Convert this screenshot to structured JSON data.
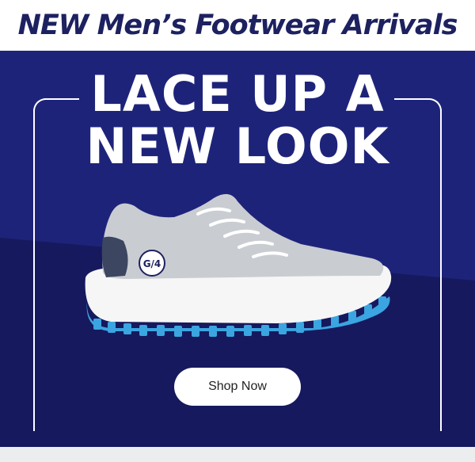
{
  "banner": {
    "title": "NEW Men’s Footwear Arrivals"
  },
  "hero": {
    "headline_line1": "LACE UP A",
    "headline_line2": "NEW LOOK",
    "cta_label": "Shop Now",
    "product_image": "golf-shoe"
  },
  "colors": {
    "brand_navy": "#1d2160",
    "hero_bg": "#1e237a",
    "hero_bg_shadow": "#16195e",
    "shoe_upper": "#c9cdd2",
    "sole_accent": "#3aa5e0",
    "button_bg": "#ffffff"
  }
}
